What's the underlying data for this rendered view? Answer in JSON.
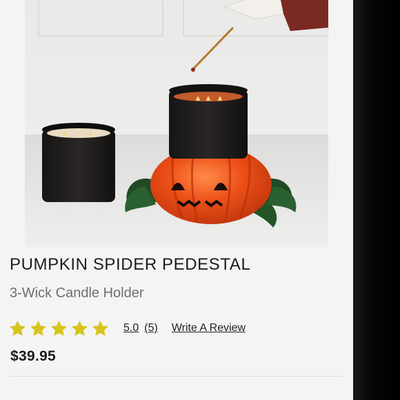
{
  "product": {
    "image_alt_icon": "candle-pedestal-photo",
    "title": "PUMPKIN SPIDER PEDESTAL",
    "subtitle": "3-Wick Candle Holder",
    "rating": {
      "stars": 5,
      "max_stars": 5,
      "score": "5.0",
      "count": "(5)",
      "write_review_label": "Write A Review",
      "star_color": "#d7c41c"
    },
    "price": "$39.95"
  },
  "colors": {
    "pumpkin_orange": "#e85a1e",
    "candle_black": "#1c1a1a",
    "leaf_green": "#1f4a24"
  }
}
